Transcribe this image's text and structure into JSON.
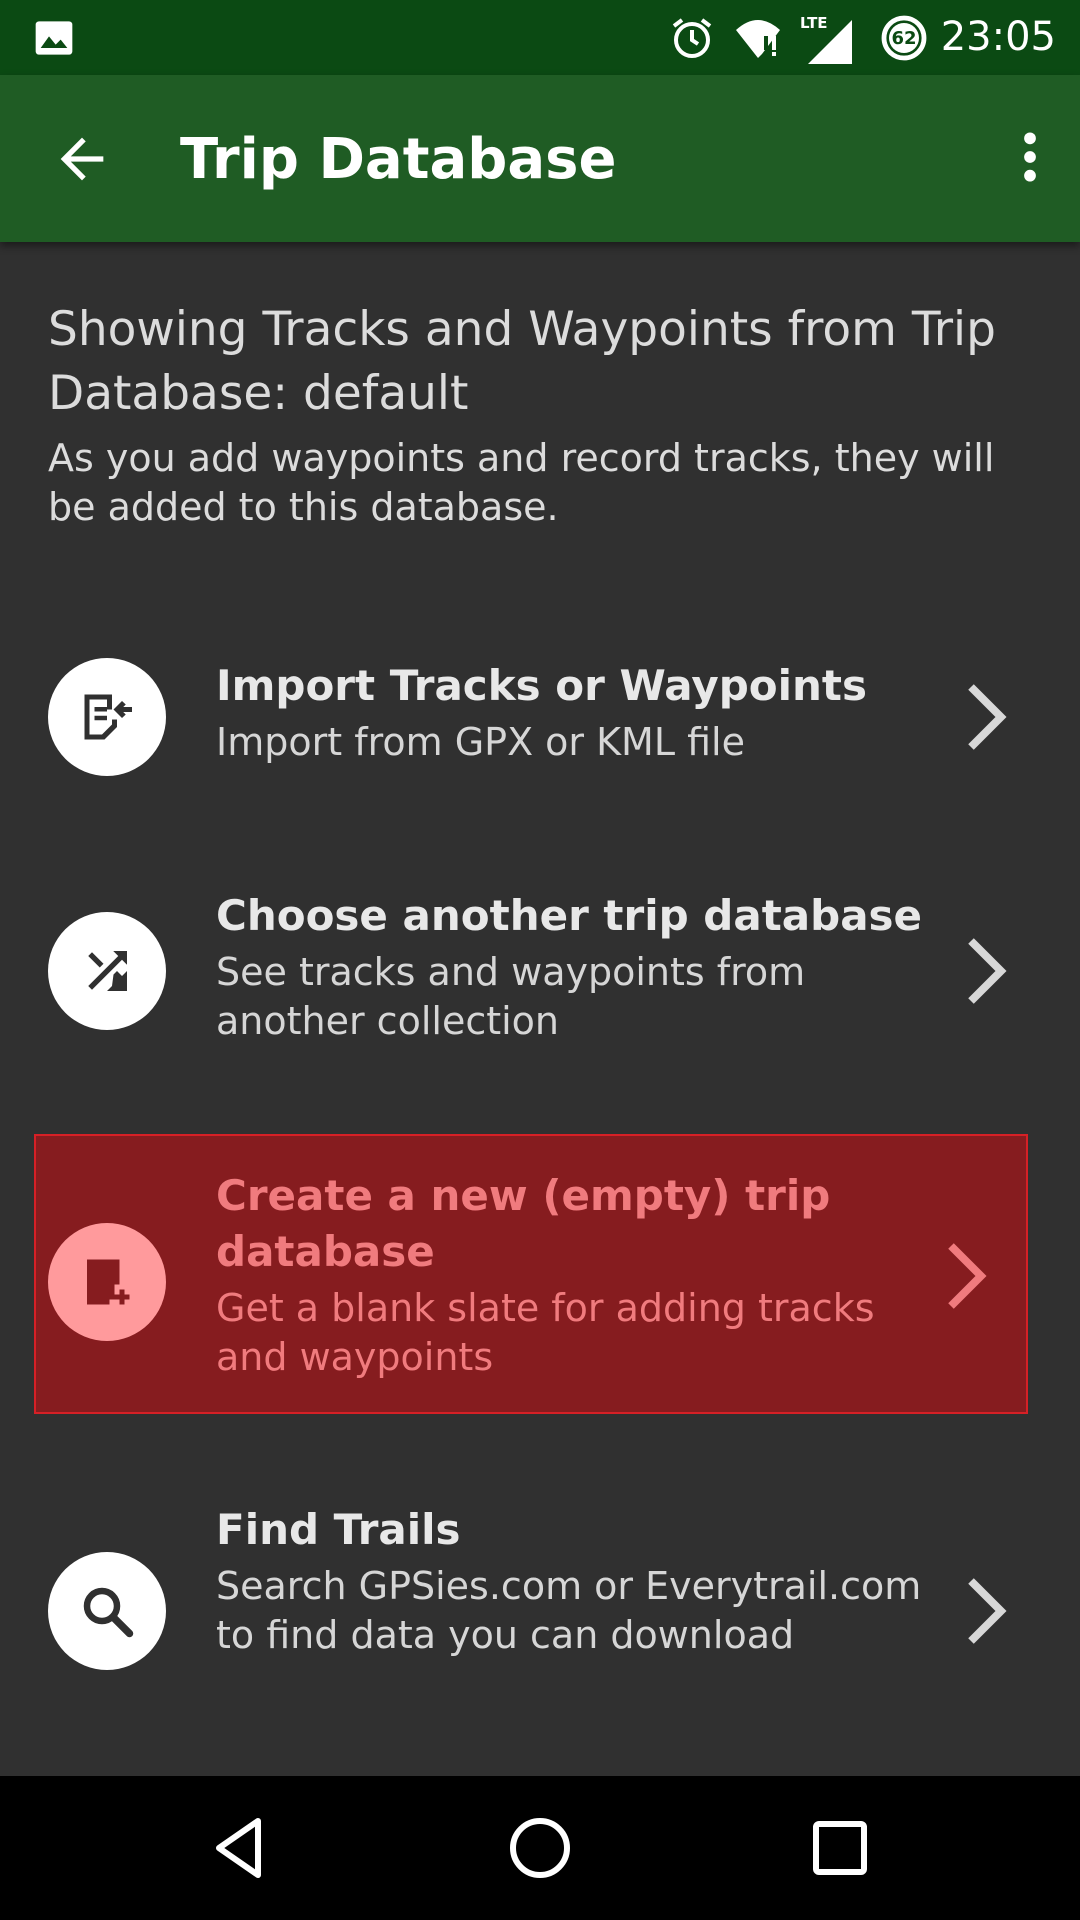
{
  "status_bar": {
    "time": "23:05",
    "battery_level": "62",
    "network_label": "LTE",
    "icons": [
      "image-icon",
      "alarm-icon",
      "wifi-icon",
      "lte-signal-icon",
      "battery-icon"
    ]
  },
  "app_bar": {
    "title": "Trip Database",
    "back_icon": "back-arrow-icon",
    "more_icon": "more-vert-icon"
  },
  "intro": {
    "title": "Showing Tracks and Waypoints from Trip Database: default",
    "text": "As you add waypoints and record tracks, they will be added to this database."
  },
  "options": [
    {
      "icon": "import-icon",
      "title": "Import Tracks or Waypoints",
      "subtitle": "Import from GPX or KML file",
      "selected": false
    },
    {
      "icon": "shuffle-icon",
      "title": "Choose another trip database",
      "subtitle": "See tracks and waypoints from another collection",
      "selected": false
    },
    {
      "icon": "new-database-icon",
      "title": "Create a new (empty) trip database",
      "subtitle": "Get a blank slate for adding tracks and waypoints",
      "selected": true
    },
    {
      "icon": "search-icon",
      "title": "Find Trails",
      "subtitle": "Search GPSies.com or Everytrail.com to find data you can download",
      "selected": false
    }
  ],
  "colors": {
    "status_bar": "#0b4a13",
    "app_bar": "#1f5c24",
    "background": "#303030",
    "selected_row": "#861c1f",
    "selected_border": "#d62026",
    "selected_text": "#f07b7e"
  },
  "nav_bar": {
    "buttons": [
      "back-triangle-icon",
      "home-circle-icon",
      "recents-square-icon"
    ]
  }
}
